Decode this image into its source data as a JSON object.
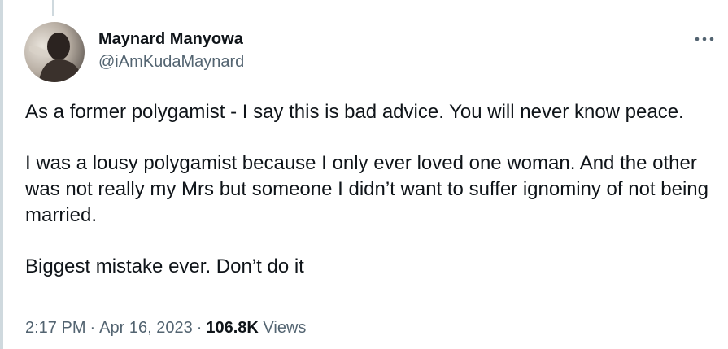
{
  "author": {
    "display_name": "Maynard Manyowa",
    "handle": "@iAmKudaMaynard"
  },
  "tweet": {
    "paragraphs": [
      "As a former polygamist - I say this is bad advice. You will never know peace.",
      "I was a lousy polygamist because I only ever loved one woman. And the other was not really my Mrs but someone I didn’t want to suffer ignominy of not being married.",
      "Biggest mistake ever. Don’t do it"
    ],
    "time": "2:17 PM",
    "separator": "·",
    "date": "Apr 16, 2023",
    "views_count": "106.8K",
    "views_label": "Views"
  },
  "icons": {
    "more": "more-horizontal-icon"
  },
  "colors": {
    "primary_text": "#0f1419",
    "secondary_text": "#536471",
    "thread_line": "#cfd9de"
  }
}
